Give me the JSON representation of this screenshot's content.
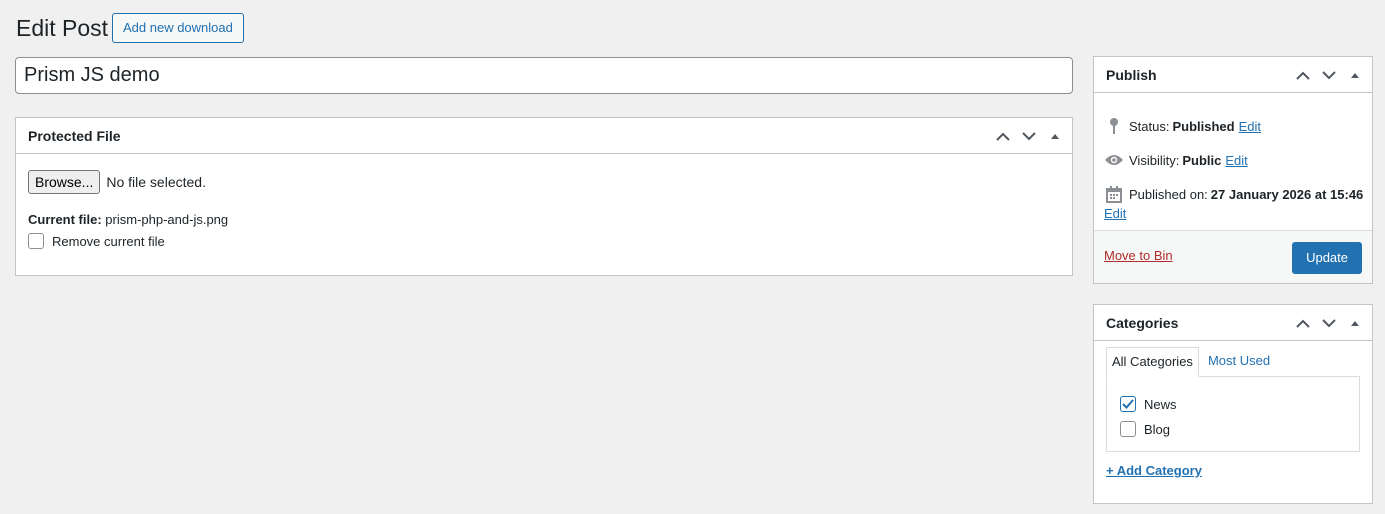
{
  "header": {
    "title": "Edit Post",
    "add_new_label": "Add new download"
  },
  "post": {
    "title_value": "Prism JS demo"
  },
  "protected_file": {
    "title": "Protected File",
    "browse_label": "Browse...",
    "no_file_text": "No file selected.",
    "current_file_label": "Current file:",
    "current_file_value": "prism-php-and-js.png",
    "remove_label": "Remove current file",
    "remove_checked": false
  },
  "publish": {
    "title": "Publish",
    "status_label": "Status:",
    "status_value": "Published",
    "visibility_label": "Visibility:",
    "visibility_value": "Public",
    "published_on_label": "Published on:",
    "published_on_value": "27 January 2026 at 15:46",
    "edit_label": "Edit",
    "move_to_bin_label": "Move to Bin",
    "update_label": "Update"
  },
  "categories": {
    "title": "Categories",
    "tabs": [
      "All Categories",
      "Most Used"
    ],
    "items": [
      {
        "label": "News",
        "checked": true
      },
      {
        "label": "Blog",
        "checked": false
      }
    ],
    "add_label": "+ Add Category"
  },
  "colors": {
    "accent": "#2271b1",
    "danger": "#b32d2e",
    "background": "#f0f0f1"
  },
  "icons": [
    "chevron-up-icon",
    "chevron-down-icon",
    "toggle-arrow-icon",
    "pin-icon",
    "eye-icon",
    "calendar-icon",
    "checkmark-icon"
  ]
}
